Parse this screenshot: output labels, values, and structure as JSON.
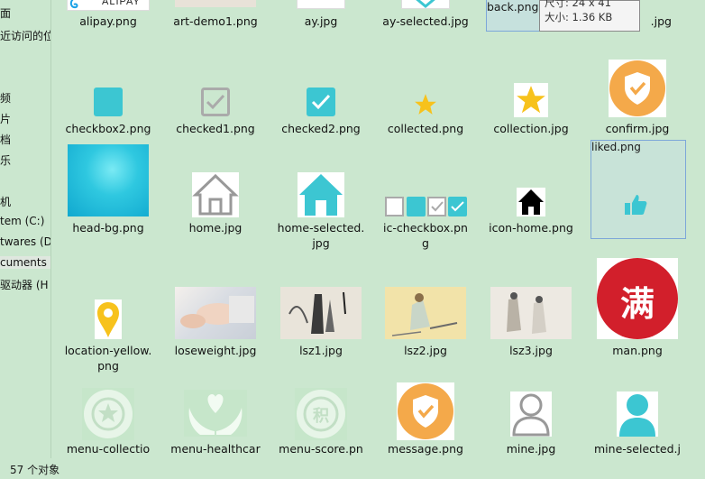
{
  "sidebar": {
    "items": [
      {
        "label": "面"
      },
      {
        "label": "近访问的位"
      },
      {
        "label": "频"
      },
      {
        "label": "片"
      },
      {
        "label": "档"
      },
      {
        "label": "乐"
      },
      {
        "label": "机"
      },
      {
        "label": "tem (C:)"
      },
      {
        "label": "twares (D"
      },
      {
        "label": "cuments ("
      },
      {
        "label": "驱动器 (H"
      }
    ]
  },
  "tooltip": {
    "size_line": "尺寸: 24 x 41",
    "filesize_line": "大小: 1.36 KB"
  },
  "files": {
    "row0": [
      "alipay.png",
      "art-demo1.png",
      "ay.jpg",
      "ay-selected.jpg",
      "back.png",
      ".jpg"
    ],
    "row1": [
      "checkbox2.png",
      "checked1.png",
      "checked2.png",
      "collected.png",
      "collection.jpg",
      "confirm.jpg"
    ],
    "row2": [
      "head-bg.png",
      "home.jpg",
      "home-selected.jpg",
      "ic-checkbox.png",
      "icon-home.png",
      "liked.png"
    ],
    "row3": [
      "location-yellow.png",
      "loseweight.jpg",
      "lsz1.jpg",
      "lsz2.jpg",
      "lsz3.jpg",
      "man.png"
    ],
    "row4": [
      "menu-collection",
      "menu-healthcar",
      "menu-score.pn",
      "message.png",
      "mine.jpg",
      "mine-selected.j"
    ]
  },
  "thumb_text": {
    "alipay": "ALIPAY",
    "man": "满",
    "score": "积"
  },
  "status": {
    "count": "57 个对象"
  },
  "colors": {
    "bg": "#cbe7cf",
    "teal": "#3cc6d2",
    "orange": "#f4a94a",
    "red": "#d21f2b",
    "yellow": "#f7c21c"
  }
}
